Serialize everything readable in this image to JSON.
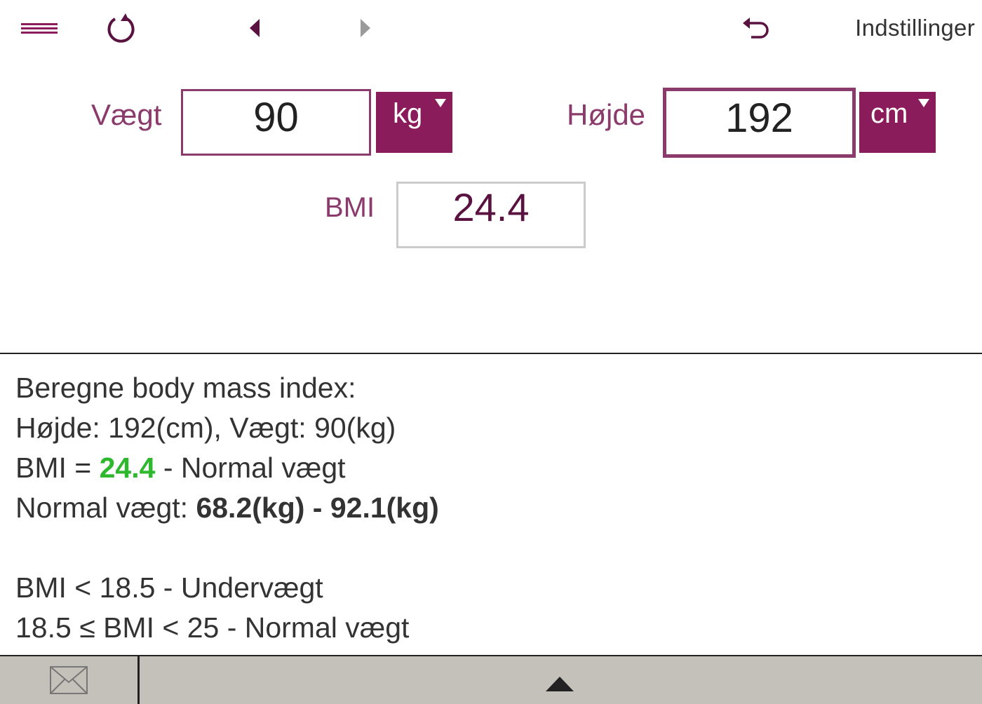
{
  "toolbar": {
    "menu_icon": "hamburger-icon",
    "refresh_icon": "refresh-icon",
    "back_icon": "arrow-left-icon",
    "forward_icon": "arrow-right-icon",
    "undo_icon": "undo-icon",
    "settings_label": "Indstillinger"
  },
  "form": {
    "weight": {
      "label": "Vægt",
      "value": "90",
      "unit": "kg"
    },
    "height": {
      "label": "Højde",
      "value": "192",
      "unit": "cm"
    },
    "bmi": {
      "label": "BMI",
      "value": "24.4"
    }
  },
  "result": {
    "heading": "Beregne body mass index:",
    "input_summary": "Højde: 192(cm), Vægt: 90(kg)",
    "bmi_prefix": "BMI = ",
    "bmi_value": "24.4",
    "bmi_suffix": " - Normal vægt",
    "normal_prefix": "Normal vægt: ",
    "normal_range": "68.2(kg) - 92.1(kg)",
    "categories": [
      "BMI < 18.5 - Undervægt",
      "18.5 ≤ BMI < 25 - Normal vægt"
    ]
  },
  "footer": {
    "mail_icon": "mail-icon",
    "expand_icon": "triangle-up-icon"
  },
  "colors": {
    "accent": "#8b1c5c",
    "label": "#8b3b6b",
    "bmi_normal": "#2eb82e",
    "footer_bg": "#c3c1b9"
  }
}
